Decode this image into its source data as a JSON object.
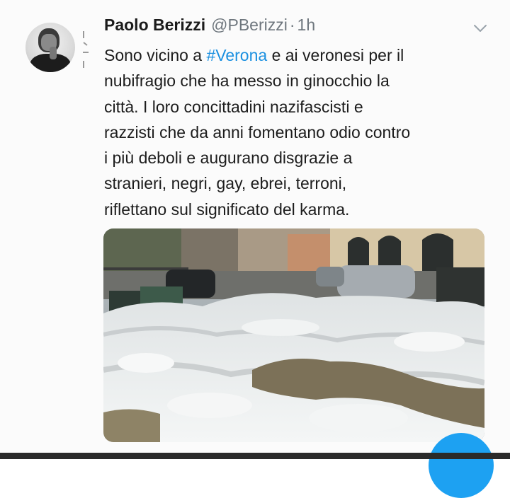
{
  "tweet": {
    "author_name": "Paolo Berizzi",
    "handle": "@PBerizzi",
    "separator": "·",
    "time": "1h",
    "text_lines": [
      {
        "before": "Sono vicino a ",
        "hashtag": "#Verona",
        "after": " e ai veronesi per il"
      },
      {
        "text": "nubifragio che ha messo in ginocchio la"
      },
      {
        "text": "città. I loro concittadini nazifascisti e"
      },
      {
        "text": "razzisti che da anni fomentano odio contro"
      },
      {
        "text": "i più deboli e augurano disgrazie a"
      },
      {
        "text": "stranieri, negri, gay, ebrei, terroni,"
      },
      {
        "text": "riflettano sul significato del karma."
      }
    ]
  },
  "icons": {
    "menu": "chevron-down-icon",
    "avatar": "profile-photo"
  },
  "colors": {
    "hashtag": "#1b90e0",
    "secondary_text": "#6e767d",
    "compose_button": "#1da1f2"
  }
}
